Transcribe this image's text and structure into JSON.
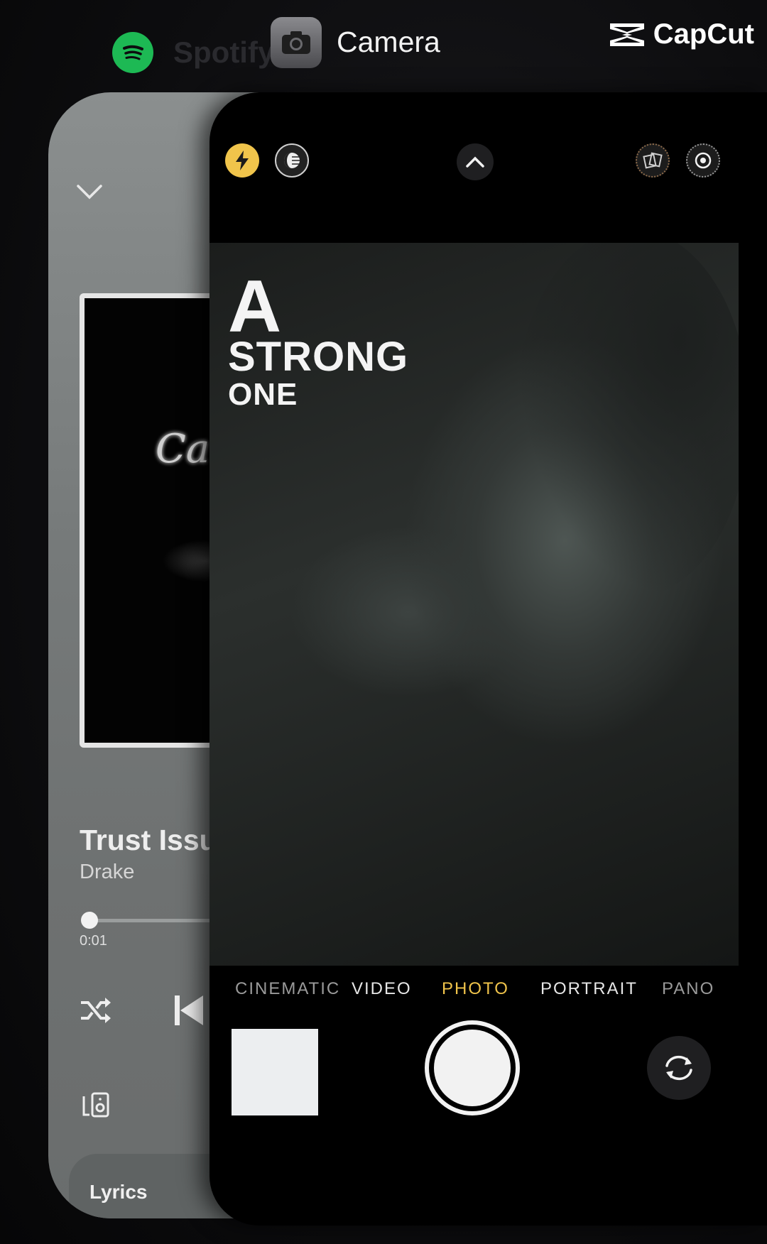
{
  "switcher": {
    "spotify_label": "Spotify",
    "camera_label": "Camera",
    "watermark": "CapCut"
  },
  "spotify": {
    "track_title": "Trust Issu",
    "artist": "Drake",
    "elapsed": "0:01",
    "progress_fraction": 0.01,
    "lyrics_label": "Lyrics",
    "accent": "#1db954"
  },
  "camera": {
    "overlay": {
      "line1": "A",
      "line2": "STRONG",
      "line3": "ONE"
    },
    "modes": [
      "CINEMATIC",
      "VIDEO",
      "PHOTO",
      "PORTRAIT",
      "PANO"
    ],
    "active_mode": "PHOTO",
    "accent": "#f0c44b"
  }
}
